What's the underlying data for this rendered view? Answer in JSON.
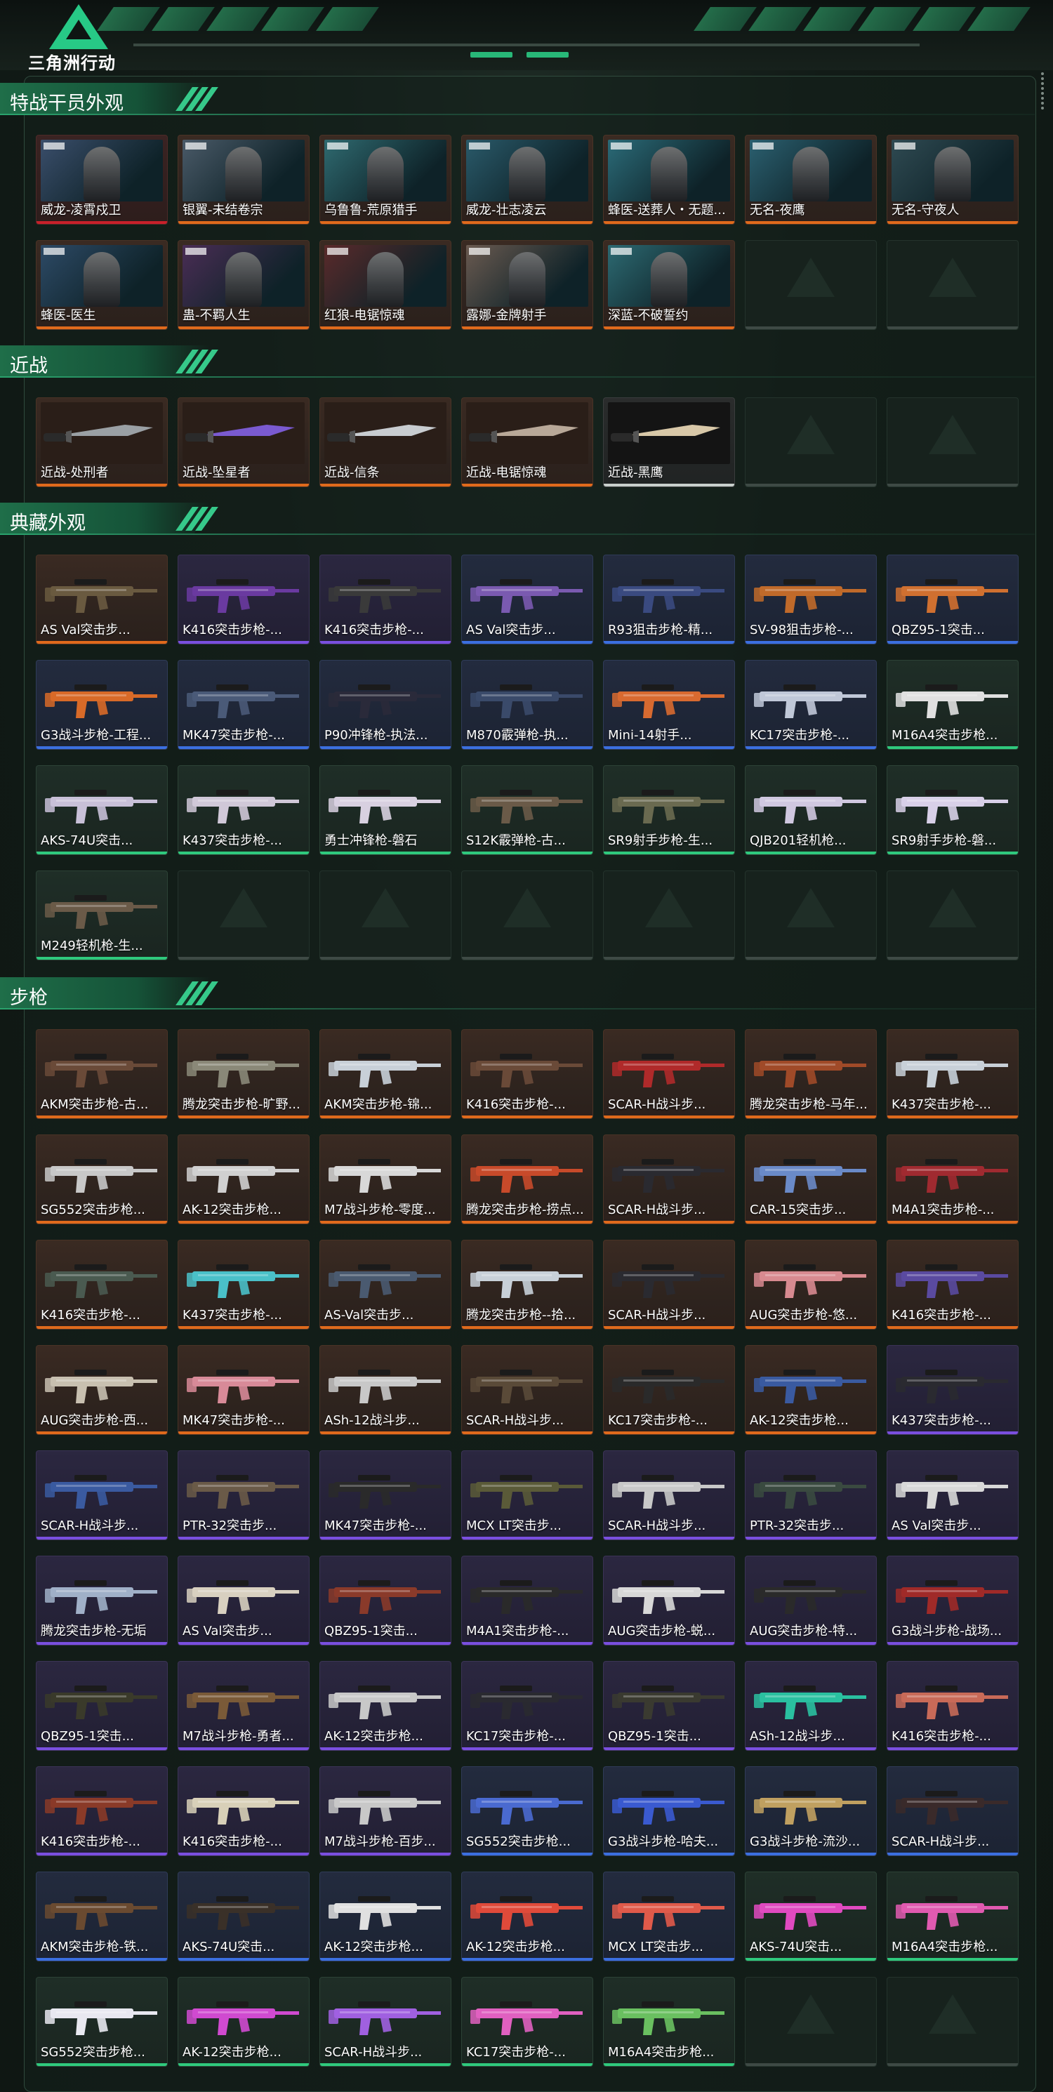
{
  "app": {
    "brand_name": "三角洲行动"
  },
  "colors": {
    "accent": "#28b878",
    "orange": "#e06a1c",
    "purple": "#7a4fe0",
    "blue": "#3b6fe0",
    "green": "#2fc97d",
    "red": "#c8202a"
  },
  "sections": [
    {
      "title": "特战干员外观",
      "items": [
        {
          "label": "威龙-凌霄戍卫",
          "rarity": "red",
          "kind": "portrait",
          "tint": "#3a4e6b"
        },
        {
          "label": "银翼-未结卷宗",
          "rarity": "orange",
          "kind": "portrait",
          "tint": "#4a5a68"
        },
        {
          "label": "乌鲁鲁-荒原猎手",
          "rarity": "orange",
          "kind": "portrait",
          "tint": "#2f6a70"
        },
        {
          "label": "威龙-壮志凌云",
          "rarity": "orange",
          "kind": "portrait",
          "tint": "#2a5a6a"
        },
        {
          "label": "蜂医-送葬人・无题...",
          "rarity": "orange",
          "kind": "portrait",
          "tint": "#2b6b78"
        },
        {
          "label": "无名-夜鹰",
          "rarity": "orange",
          "kind": "portrait",
          "tint": "#2b6070"
        },
        {
          "label": "无名-守夜人",
          "rarity": "orange",
          "kind": "portrait",
          "tint": "#2f4a52"
        },
        {
          "label": "蜂医-医生",
          "rarity": "orange",
          "kind": "portrait",
          "tint": "#2d4a66"
        },
        {
          "label": "蛊-不羁人生",
          "rarity": "orange",
          "kind": "portrait",
          "tint": "#4a2d55"
        },
        {
          "label": "红狼-电锯惊魂",
          "rarity": "orange",
          "kind": "portrait",
          "tint": "#5a2a2a"
        },
        {
          "label": "露娜-金牌射手",
          "rarity": "orange",
          "kind": "portrait",
          "tint": "#6a5a50"
        },
        {
          "label": "深蓝-不破誓约",
          "rarity": "orange",
          "kind": "portrait",
          "tint": "#2d6a72"
        },
        {
          "label": "",
          "rarity": "empty"
        },
        {
          "label": "",
          "rarity": "empty"
        }
      ]
    },
    {
      "title": "近战",
      "items": [
        {
          "label": "近战-处刑者",
          "rarity": "orange",
          "kind": "knife",
          "tint": "#9aa0a4"
        },
        {
          "label": "近战-坠星者",
          "rarity": "orange",
          "kind": "knife",
          "tint": "#7a5ad0"
        },
        {
          "label": "近战-信条",
          "rarity": "orange",
          "kind": "knife",
          "tint": "#c8ccd0"
        },
        {
          "label": "近战-电锯惊魂",
          "rarity": "orange",
          "kind": "knife",
          "tint": "#b8a898"
        },
        {
          "label": "近战-黑鹰",
          "rarity": "white",
          "kind": "knife",
          "tint": "#d8c8a8"
        },
        {
          "label": "",
          "rarity": "empty"
        },
        {
          "label": "",
          "rarity": "empty"
        }
      ]
    },
    {
      "title": "典藏外观",
      "items": [
        {
          "label": "AS Val突击步...",
          "rarity": "orange",
          "kind": "gun",
          "tint": "#6a5a40"
        },
        {
          "label": "K416突击步枪-...",
          "rarity": "purple",
          "kind": "gun",
          "tint": "#6a3aa0"
        },
        {
          "label": "K416突击步枪-...",
          "rarity": "purple",
          "kind": "gun",
          "tint": "#3a3a3a"
        },
        {
          "label": "AS Val突击步...",
          "rarity": "blue",
          "kind": "gun",
          "tint": "#7a5ab0"
        },
        {
          "label": "R93狙击步枪-精...",
          "rarity": "blue",
          "kind": "gun",
          "tint": "#3a4a80"
        },
        {
          "label": "SV-98狙击步枪-...",
          "rarity": "blue",
          "kind": "gun",
          "tint": "#c06a2a"
        },
        {
          "label": "QBZ95-1突击...",
          "rarity": "blue",
          "kind": "gun",
          "tint": "#d07030"
        },
        {
          "label": "G3战斗步枪-工程...",
          "rarity": "blue",
          "kind": "gun",
          "tint": "#d86a28"
        },
        {
          "label": "MK47突击步枪-...",
          "rarity": "blue",
          "kind": "gun",
          "tint": "#4a5a78"
        },
        {
          "label": "P90冲锋枪-执法...",
          "rarity": "blue",
          "kind": "gun",
          "tint": "#2a2a3a"
        },
        {
          "label": "M870霰弹枪-执...",
          "rarity": "blue",
          "kind": "gun",
          "tint": "#3a4a6a"
        },
        {
          "label": "Mini-14射手...",
          "rarity": "blue",
          "kind": "gun",
          "tint": "#d86a30"
        },
        {
          "label": "KC17突击步枪-...",
          "rarity": "blue",
          "kind": "gun",
          "tint": "#c0c8d8"
        },
        {
          "label": "M16A4突击步枪...",
          "rarity": "green",
          "kind": "gun",
          "tint": "#e0e0e0"
        },
        {
          "label": "AKS-74U突击...",
          "rarity": "green",
          "kind": "gun",
          "tint": "#c8c0d8"
        },
        {
          "label": "K437突击步枪-...",
          "rarity": "green",
          "kind": "gun",
          "tint": "#d0c8d8"
        },
        {
          "label": "勇士冲锋枪-磐石",
          "rarity": "green",
          "kind": "gun",
          "tint": "#d8d0e0"
        },
        {
          "label": "S12K霰弹枪-古...",
          "rarity": "green",
          "kind": "gun",
          "tint": "#6a5a48"
        },
        {
          "label": "SR9射手步枪-生...",
          "rarity": "green",
          "kind": "gun",
          "tint": "#6a6a50"
        },
        {
          "label": "QJB201轻机枪...",
          "rarity": "green",
          "kind": "gun",
          "tint": "#d0c8e0"
        },
        {
          "label": "SR9射手步枪-磐...",
          "rarity": "green",
          "kind": "gun",
          "tint": "#d8d0e8"
        },
        {
          "label": "M249轻机枪-生...",
          "rarity": "green",
          "kind": "gun",
          "tint": "#6a5a48"
        },
        {
          "label": "",
          "rarity": "empty"
        },
        {
          "label": "",
          "rarity": "empty"
        },
        {
          "label": "",
          "rarity": "empty"
        },
        {
          "label": "",
          "rarity": "empty"
        },
        {
          "label": "",
          "rarity": "empty"
        },
        {
          "label": "",
          "rarity": "empty"
        }
      ]
    },
    {
      "title": "步枪",
      "items": [
        {
          "label": "AKM突击步枪-古...",
          "rarity": "orange",
          "kind": "gun",
          "tint": "#6a4a38"
        },
        {
          "label": "腾龙突击步枪-旷野...",
          "rarity": "orange",
          "kind": "gun",
          "tint": "#8a8878"
        },
        {
          "label": "AKM突击步枪-锦...",
          "rarity": "orange",
          "kind": "gun",
          "tint": "#c8d0d8"
        },
        {
          "label": "K416突击步枪-...",
          "rarity": "orange",
          "kind": "gun",
          "tint": "#6a4a38"
        },
        {
          "label": "SCAR-H战斗步...",
          "rarity": "orange",
          "kind": "gun",
          "tint": "#b02a2a"
        },
        {
          "label": "腾龙突击步枪-马年...",
          "rarity": "orange",
          "kind": "gun",
          "tint": "#a04a28"
        },
        {
          "label": "K437突击步枪-...",
          "rarity": "orange",
          "kind": "gun",
          "tint": "#c8d0d8"
        },
        {
          "label": "SG552突击步枪...",
          "rarity": "orange",
          "kind": "gun",
          "tint": "#c8c8c8"
        },
        {
          "label": "AK-12突击步枪...",
          "rarity": "orange",
          "kind": "gun",
          "tint": "#d0d0d0"
        },
        {
          "label": "M7战斗步枪-零度...",
          "rarity": "orange",
          "kind": "gun",
          "tint": "#d8d8d8"
        },
        {
          "label": "腾龙突击步枪-捞点...",
          "rarity": "orange",
          "kind": "gun",
          "tint": "#c84a2a"
        },
        {
          "label": "SCAR-H战斗步...",
          "rarity": "orange",
          "kind": "gun",
          "tint": "#2a2a30"
        },
        {
          "label": "CAR-15突击步...",
          "rarity": "orange",
          "kind": "gun",
          "tint": "#6a8ac8"
        },
        {
          "label": "M4A1突击步枪-...",
          "rarity": "orange",
          "kind": "gun",
          "tint": "#a02a30"
        },
        {
          "label": "K416突击步枪-...",
          "rarity": "orange",
          "kind": "gun",
          "tint": "#4a5a50"
        },
        {
          "label": "K437突击步枪-...",
          "rarity": "orange",
          "kind": "gun",
          "tint": "#4ac0c8"
        },
        {
          "label": "AS-Val突击步...",
          "rarity": "orange",
          "kind": "gun",
          "tint": "#4a5a70"
        },
        {
          "label": "腾龙突击步枪--拾...",
          "rarity": "orange",
          "kind": "gun",
          "tint": "#c8d0d8"
        },
        {
          "label": "SCAR-H战斗步...",
          "rarity": "orange",
          "kind": "gun",
          "tint": "#2a2a30"
        },
        {
          "label": "AUG突击步枪-悠...",
          "rarity": "orange",
          "kind": "gun",
          "tint": "#d88a90"
        },
        {
          "label": "K416突击步枪-...",
          "rarity": "orange",
          "kind": "gun",
          "tint": "#5a4aa0"
        },
        {
          "label": "AUG突击步枪-西...",
          "rarity": "orange",
          "kind": "gun",
          "tint": "#c8c0b0"
        },
        {
          "label": "MK47突击步枪-...",
          "rarity": "orange",
          "kind": "gun",
          "tint": "#d88a98"
        },
        {
          "label": "ASh-12战斗步...",
          "rarity": "orange",
          "kind": "gun",
          "tint": "#c8c8c8"
        },
        {
          "label": "SCAR-H战斗步...",
          "rarity": "orange",
          "kind": "gun",
          "tint": "#5a4a38"
        },
        {
          "label": "KC17突击步枪-...",
          "rarity": "orange",
          "kind": "gun",
          "tint": "#2a2a2a"
        },
        {
          "label": "AK-12突击步枪...",
          "rarity": "orange",
          "kind": "gun",
          "tint": "#3a5aa0"
        },
        {
          "label": "K437突击步枪-...",
          "rarity": "purple",
          "kind": "gun",
          "tint": "#2a2a30"
        },
        {
          "label": "SCAR-H战斗步...",
          "rarity": "purple",
          "kind": "gun",
          "tint": "#3a5aa0"
        },
        {
          "label": "PTR-32突击步...",
          "rarity": "purple",
          "kind": "gun",
          "tint": "#6a5a48"
        },
        {
          "label": "MK47突击步枪-...",
          "rarity": "purple",
          "kind": "gun",
          "tint": "#2a2a2a"
        },
        {
          "label": "MCX LT突击步...",
          "rarity": "purple",
          "kind": "gun",
          "tint": "#5a5a38"
        },
        {
          "label": "SCAR-H战斗步...",
          "rarity": "purple",
          "kind": "gun",
          "tint": "#c8c8c8"
        },
        {
          "label": "PTR-32突击步...",
          "rarity": "purple",
          "kind": "gun",
          "tint": "#3a4a40"
        },
        {
          "label": "AS Val突击步...",
          "rarity": "purple",
          "kind": "gun",
          "tint": "#d8d8d8"
        },
        {
          "label": "腾龙突击步枪-无垢",
          "rarity": "purple",
          "kind": "gun",
          "tint": "#a0b0c8"
        },
        {
          "label": "AS Val突击步...",
          "rarity": "purple",
          "kind": "gun",
          "tint": "#d8d0c0"
        },
        {
          "label": "QBZ95-1突击...",
          "rarity": "purple",
          "kind": "gun",
          "tint": "#8a3a2a"
        },
        {
          "label": "M4A1突击步枪-...",
          "rarity": "purple",
          "kind": "gun",
          "tint": "#2a2a2a"
        },
        {
          "label": "AUG突击步枪-蜕...",
          "rarity": "purple",
          "kind": "gun",
          "tint": "#d8d8d8"
        },
        {
          "label": "AUG突击步枪-特...",
          "rarity": "purple",
          "kind": "gun",
          "tint": "#2a2a2a"
        },
        {
          "label": "G3战斗步枪-战场...",
          "rarity": "purple",
          "kind": "gun",
          "tint": "#a02a28"
        },
        {
          "label": "QBZ95-1突击...",
          "rarity": "purple",
          "kind": "gun",
          "tint": "#3a3a2a"
        },
        {
          "label": "M7战斗步枪-勇者...",
          "rarity": "purple",
          "kind": "gun",
          "tint": "#7a5a38"
        },
        {
          "label": "AK-12突击步枪...",
          "rarity": "purple",
          "kind": "gun",
          "tint": "#c8c8c8"
        },
        {
          "label": "KC17突击步枪-...",
          "rarity": "purple",
          "kind": "gun",
          "tint": "#2a2a30"
        },
        {
          "label": "QBZ95-1突击...",
          "rarity": "purple",
          "kind": "gun",
          "tint": "#3a3a30"
        },
        {
          "label": "ASh-12战斗步...",
          "rarity": "purple",
          "kind": "gun",
          "tint": "#2ac0a0"
        },
        {
          "label": "K416突击步枪-...",
          "rarity": "purple",
          "kind": "gun",
          "tint": "#c86a58"
        },
        {
          "label": "K416突击步枪-...",
          "rarity": "purple",
          "kind": "gun",
          "tint": "#8a3a28"
        },
        {
          "label": "K416突击步枪-...",
          "rarity": "purple",
          "kind": "gun",
          "tint": "#d8d0b8"
        },
        {
          "label": "M7战斗步枪-百步...",
          "rarity": "purple",
          "kind": "gun",
          "tint": "#c8c8c8"
        },
        {
          "label": "SG552突击步枪...",
          "rarity": "blue",
          "kind": "gun",
          "tint": "#4a6ad0"
        },
        {
          "label": "G3战斗步枪-哈夫...",
          "rarity": "blue",
          "kind": "gun",
          "tint": "#3a5ad0"
        },
        {
          "label": "G3战斗步枪-流沙...",
          "rarity": "blue",
          "kind": "gun",
          "tint": "#c0a060"
        },
        {
          "label": "SCAR-H战斗步...",
          "rarity": "blue",
          "kind": "gun",
          "tint": "#3a2a2a"
        },
        {
          "label": "AKM突击步枪-铁...",
          "rarity": "blue",
          "kind": "gun",
          "tint": "#6a4a30"
        },
        {
          "label": "AKS-74U突击...",
          "rarity": "blue",
          "kind": "gun",
          "tint": "#3a3028"
        },
        {
          "label": "AK-12突击步枪...",
          "rarity": "blue",
          "kind": "gun",
          "tint": "#e0e0e0"
        },
        {
          "label": "AK-12突击步枪...",
          "rarity": "blue",
          "kind": "gun",
          "tint": "#e04a3a"
        },
        {
          "label": "MCX LT突击步...",
          "rarity": "blue",
          "kind": "gun",
          "tint": "#e05a4a"
        },
        {
          "label": "AKS-74U突击...",
          "rarity": "green",
          "kind": "gun",
          "tint": "#e04ac0"
        },
        {
          "label": "M16A4突击步枪...",
          "rarity": "green",
          "kind": "gun",
          "tint": "#e05ab0"
        },
        {
          "label": "SG552突击步枪...",
          "rarity": "green",
          "kind": "gun",
          "tint": "#e8e8f0"
        },
        {
          "label": "AK-12突击步枪...",
          "rarity": "green",
          "kind": "gun",
          "tint": "#d04ad0"
        },
        {
          "label": "SCAR-H战斗步...",
          "rarity": "green",
          "kind": "gun",
          "tint": "#a060e0"
        },
        {
          "label": "KC17突击步枪-...",
          "rarity": "green",
          "kind": "gun",
          "tint": "#e060c0"
        },
        {
          "label": "M16A4突击步枪...",
          "rarity": "green",
          "kind": "gun",
          "tint": "#6ac060"
        },
        {
          "label": "",
          "rarity": "empty"
        },
        {
          "label": "",
          "rarity": "empty"
        }
      ]
    }
  ]
}
